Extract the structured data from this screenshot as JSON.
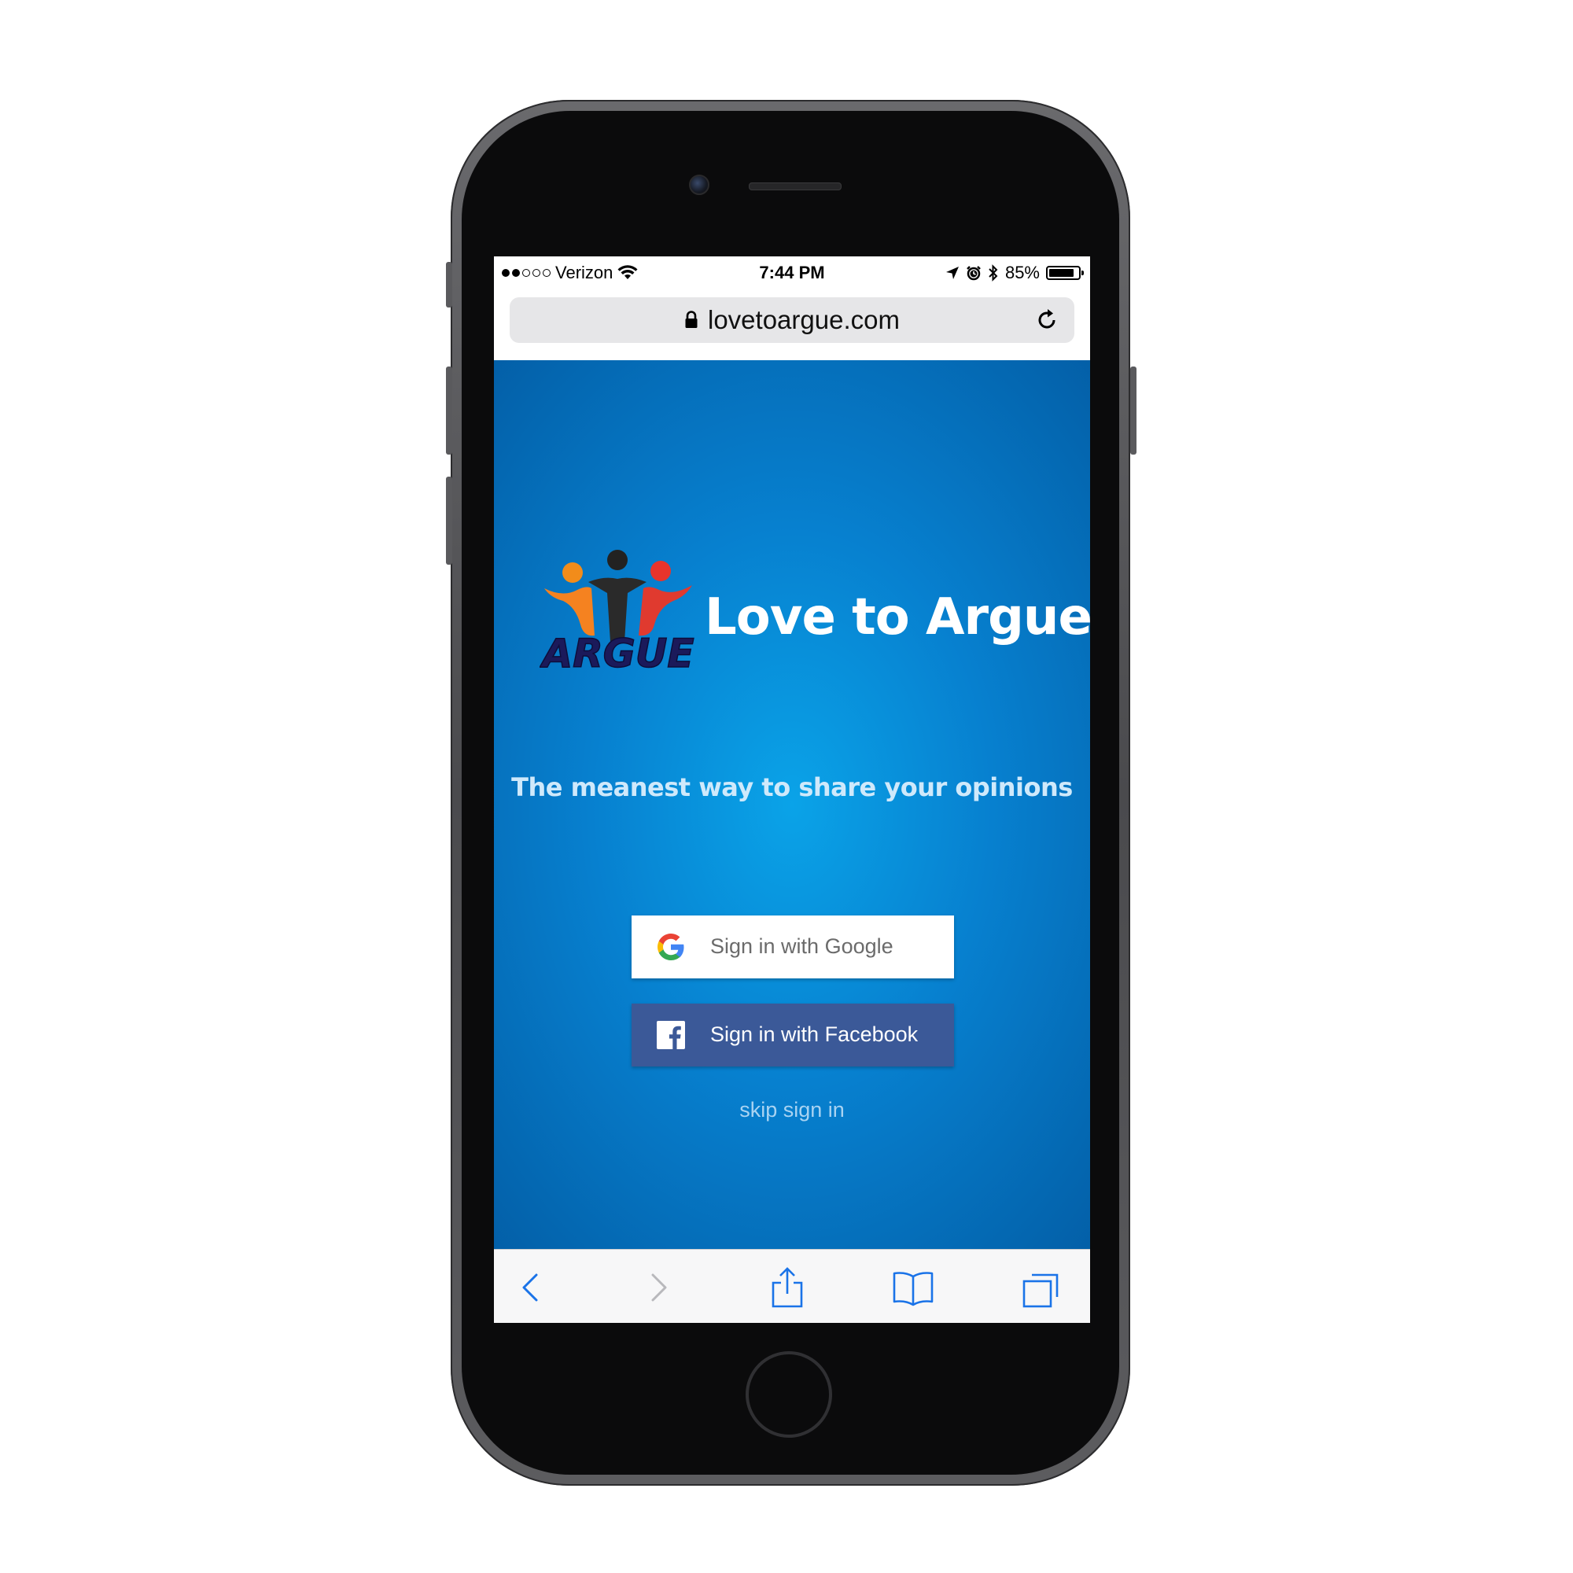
{
  "status_bar": {
    "signal_dots_filled": 2,
    "signal_dots_total": 5,
    "carrier": "Verizon",
    "time": "7:44 PM",
    "battery_percent": "85%",
    "battery_level": 0.85
  },
  "url_bar": {
    "url": "lovetoargue.com"
  },
  "hero": {
    "logo_text": "ARGUE",
    "title": "Love to Argue?",
    "tagline": "The meanest way to share your opinions"
  },
  "auth": {
    "google_label": "Sign in with Google",
    "facebook_label": "Sign in with Facebook",
    "skip_label": "skip sign in"
  },
  "icons": {
    "signal": "signal-dots-icon",
    "wifi": "wifi-icon",
    "location": "location-arrow-icon",
    "alarm": "alarm-icon",
    "bluetooth": "bluetooth-icon",
    "battery": "battery-icon",
    "lock": "lock-icon",
    "reload": "reload-icon",
    "google": "google-g-icon",
    "facebook": "facebook-f-icon",
    "back": "chevron-left-icon",
    "forward": "chevron-right-icon",
    "share": "share-icon",
    "bookmarks": "book-icon",
    "tabs": "tabs-icon"
  },
  "colors": {
    "background_center": "#0aa3e8",
    "background_edge": "#035ea6",
    "facebook_blue": "#3b5998",
    "toolbar_accent": "#1a73e8",
    "tagline": "#cfe9fb",
    "skip_link": "#a9d3f2"
  }
}
